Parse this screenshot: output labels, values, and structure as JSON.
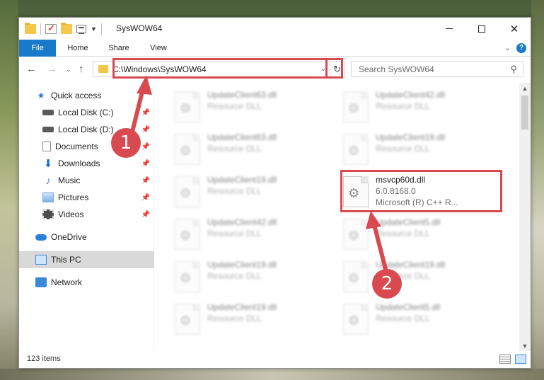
{
  "window": {
    "title": "SysWOW64"
  },
  "ribbon": {
    "tabs": [
      "File",
      "Home",
      "Share",
      "View"
    ],
    "help": "?"
  },
  "nav": {
    "address": "C:\\Windows\\SysWOW64",
    "search_placeholder": "Search SysWOW64"
  },
  "sidebar": {
    "items": [
      {
        "label": "Quick access",
        "icon": "star-icon",
        "pinned": false
      },
      {
        "label": "Local Disk (C:)",
        "icon": "drive-icon",
        "pinned": true
      },
      {
        "label": "Local Disk (D:)",
        "icon": "drive-icon",
        "pinned": true
      },
      {
        "label": "Documents",
        "icon": "document-icon",
        "pinned": true
      },
      {
        "label": "Downloads",
        "icon": "download-icon",
        "pinned": true
      },
      {
        "label": "Music",
        "icon": "music-icon",
        "pinned": true
      },
      {
        "label": "Pictures",
        "icon": "picture-icon",
        "pinned": true
      },
      {
        "label": "Videos",
        "icon": "video-icon",
        "pinned": true
      },
      {
        "label": "OneDrive",
        "icon": "cloud-icon",
        "pinned": false
      },
      {
        "label": "This PC",
        "icon": "computer-icon",
        "pinned": false,
        "selected": true
      },
      {
        "label": "Network",
        "icon": "network-icon",
        "pinned": false
      }
    ]
  },
  "files": [
    {
      "name": "UpdateClient63.dll",
      "line1": "Resource DLL",
      "line2": "",
      "blurred": true
    },
    {
      "name": "UpdateClient42.dll",
      "line1": "Resource DLL",
      "line2": "",
      "blurred": true
    },
    {
      "name": "UpdateClient63.dll",
      "line1": "Resource DLL",
      "line2": "",
      "blurred": true
    },
    {
      "name": "UpdateClient19.dll",
      "line1": "Resource DLL",
      "line2": "",
      "blurred": true
    },
    {
      "name": "UpdateClient19.dll",
      "line1": "Resource DLL",
      "line2": "",
      "blurred": true
    },
    {
      "name": "msvcp60d.dll",
      "line1": "6.0.8168.0",
      "line2": "Microsoft (R) C++ R...",
      "blurred": false
    },
    {
      "name": "UpdateClient42.dll",
      "line1": "Resource DLL",
      "line2": "",
      "blurred": true
    },
    {
      "name": "UpdateClient5.dll",
      "line1": "Resource DLL",
      "line2": "",
      "blurred": true
    },
    {
      "name": "UpdateClient19.dll",
      "line1": "Resource DLL",
      "line2": "",
      "blurred": true
    },
    {
      "name": "UpdateClient19.dll",
      "line1": "Resource DLL",
      "line2": "",
      "blurred": true
    },
    {
      "name": "UpdateClient19.dll",
      "line1": "Resource DLL",
      "line2": "",
      "blurred": true
    },
    {
      "name": "UpdateClient5.dll",
      "line1": "Resource DLL",
      "line2": "",
      "blurred": true
    }
  ],
  "status": {
    "item_count": "123 items"
  },
  "annotations": {
    "step1": "1",
    "step2": "2",
    "color": "#d84a4f"
  }
}
